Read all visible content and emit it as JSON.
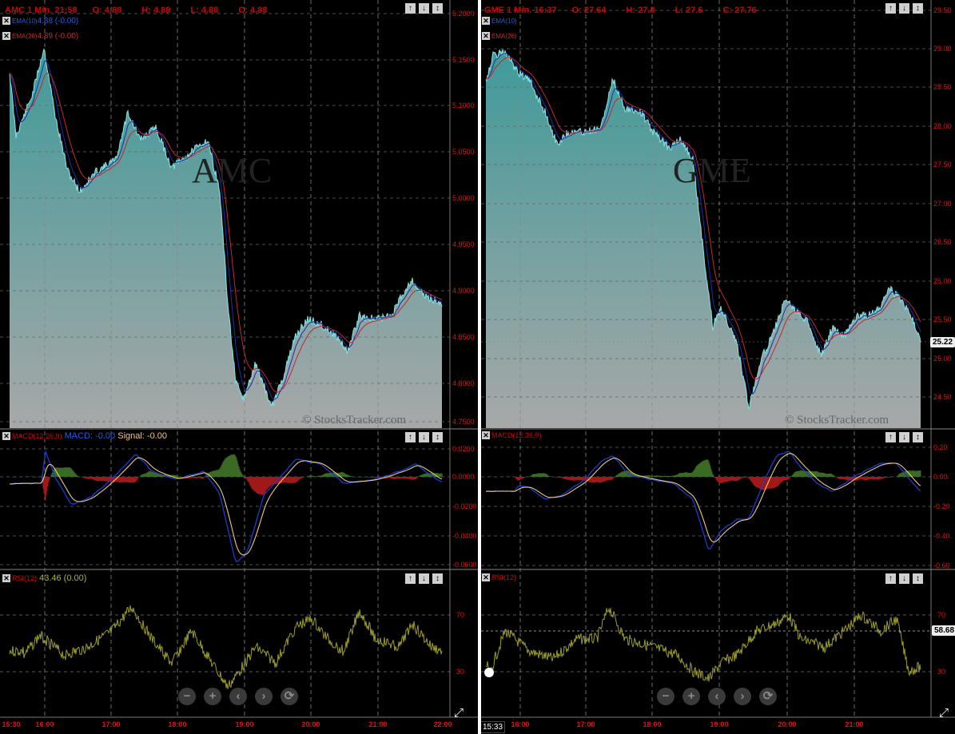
{
  "left": {
    "symbol": "AMC",
    "header": "AMC 1 Min. 21:58",
    "ohlc": {
      "o": "O: 4.88",
      "h": "H: 4.89",
      "l": "L: 4.88",
      "c": "C: 4.88"
    },
    "ema10_label": "EMA(10)",
    "ema10_value": "4.88 (-0.00)",
    "ema26_label": "EMA(26)",
    "ema26_value": "4.89 (-0.00)",
    "watermark": "AMC",
    "copyright": "© StocksTracker.com",
    "price_ticks": [
      "5.2000",
      "5.1500",
      "5.1000",
      "5.0500",
      "5.0000",
      "4.9500",
      "4.9000",
      "4.8500",
      "4.8000",
      "4.7500"
    ],
    "macd_label": "MACD(12,26,9)",
    "macd_value": "MACD: -0.00",
    "macd_signal": "Signal: -0.00",
    "macd_ticks": [
      "0.0200",
      "0.0000",
      "-0.0200",
      "-0.0400",
      "-0.0600"
    ],
    "rsi_label": "RSI(12)",
    "rsi_value": "43.46 (0.00)",
    "rsi_ticks": [
      "70",
      "30"
    ],
    "time_ticks": [
      "15:30",
      "16:00",
      "17:00",
      "18:00",
      "19:00",
      "20:00",
      "21:00",
      "22:00"
    ]
  },
  "right": {
    "symbol": "GME",
    "header": "GME 1 Min. 16:37",
    "ohlc": {
      "o": "O: 27.64",
      "h": "H: 27.8",
      "l": "L: 27.6",
      "c": "C: 27.76"
    },
    "ema10_label": "EMA(10)",
    "ema26_label": "EMA(26)",
    "watermark": "GME",
    "copyright": "© StocksTracker.com",
    "price_ticks": [
      "29.50",
      "29.00",
      "28.50",
      "28.00",
      "27.50",
      "27.00",
      "26.50",
      "26.00",
      "25.50",
      "25.00",
      "24.50"
    ],
    "current_price": "25.22",
    "macd_label": "MACD(12,26,9)",
    "macd_ticks": [
      "0.20",
      "0.00",
      "-0.20",
      "-0.40",
      "-0.60"
    ],
    "rsi_label": "RSI(12)",
    "rsi_ticks": [
      "70",
      "30"
    ],
    "rsi_current": "58.68",
    "time_ticks": [
      "16:00",
      "17:00",
      "18:00",
      "19:00",
      "20:00",
      "21:00"
    ],
    "cursor_time": "15:33"
  },
  "nav_buttons": [
    "−",
    "+",
    "‹",
    "›",
    "⟳"
  ],
  "panel_controls": [
    "↑",
    "↓",
    "↕"
  ],
  "colors": {
    "price_line": "#7fe0e0",
    "ema_fast": "#2a5bd7",
    "ema_slow": "#c0282d",
    "macd_line": "#1a3cd0",
    "signal_line": "#f2c87a",
    "hist_pos": "#3b6a24",
    "hist_neg": "#a01818",
    "rsi_line": "#9c9c2a",
    "tick_text": "#e01010",
    "grid": "#777"
  }
}
